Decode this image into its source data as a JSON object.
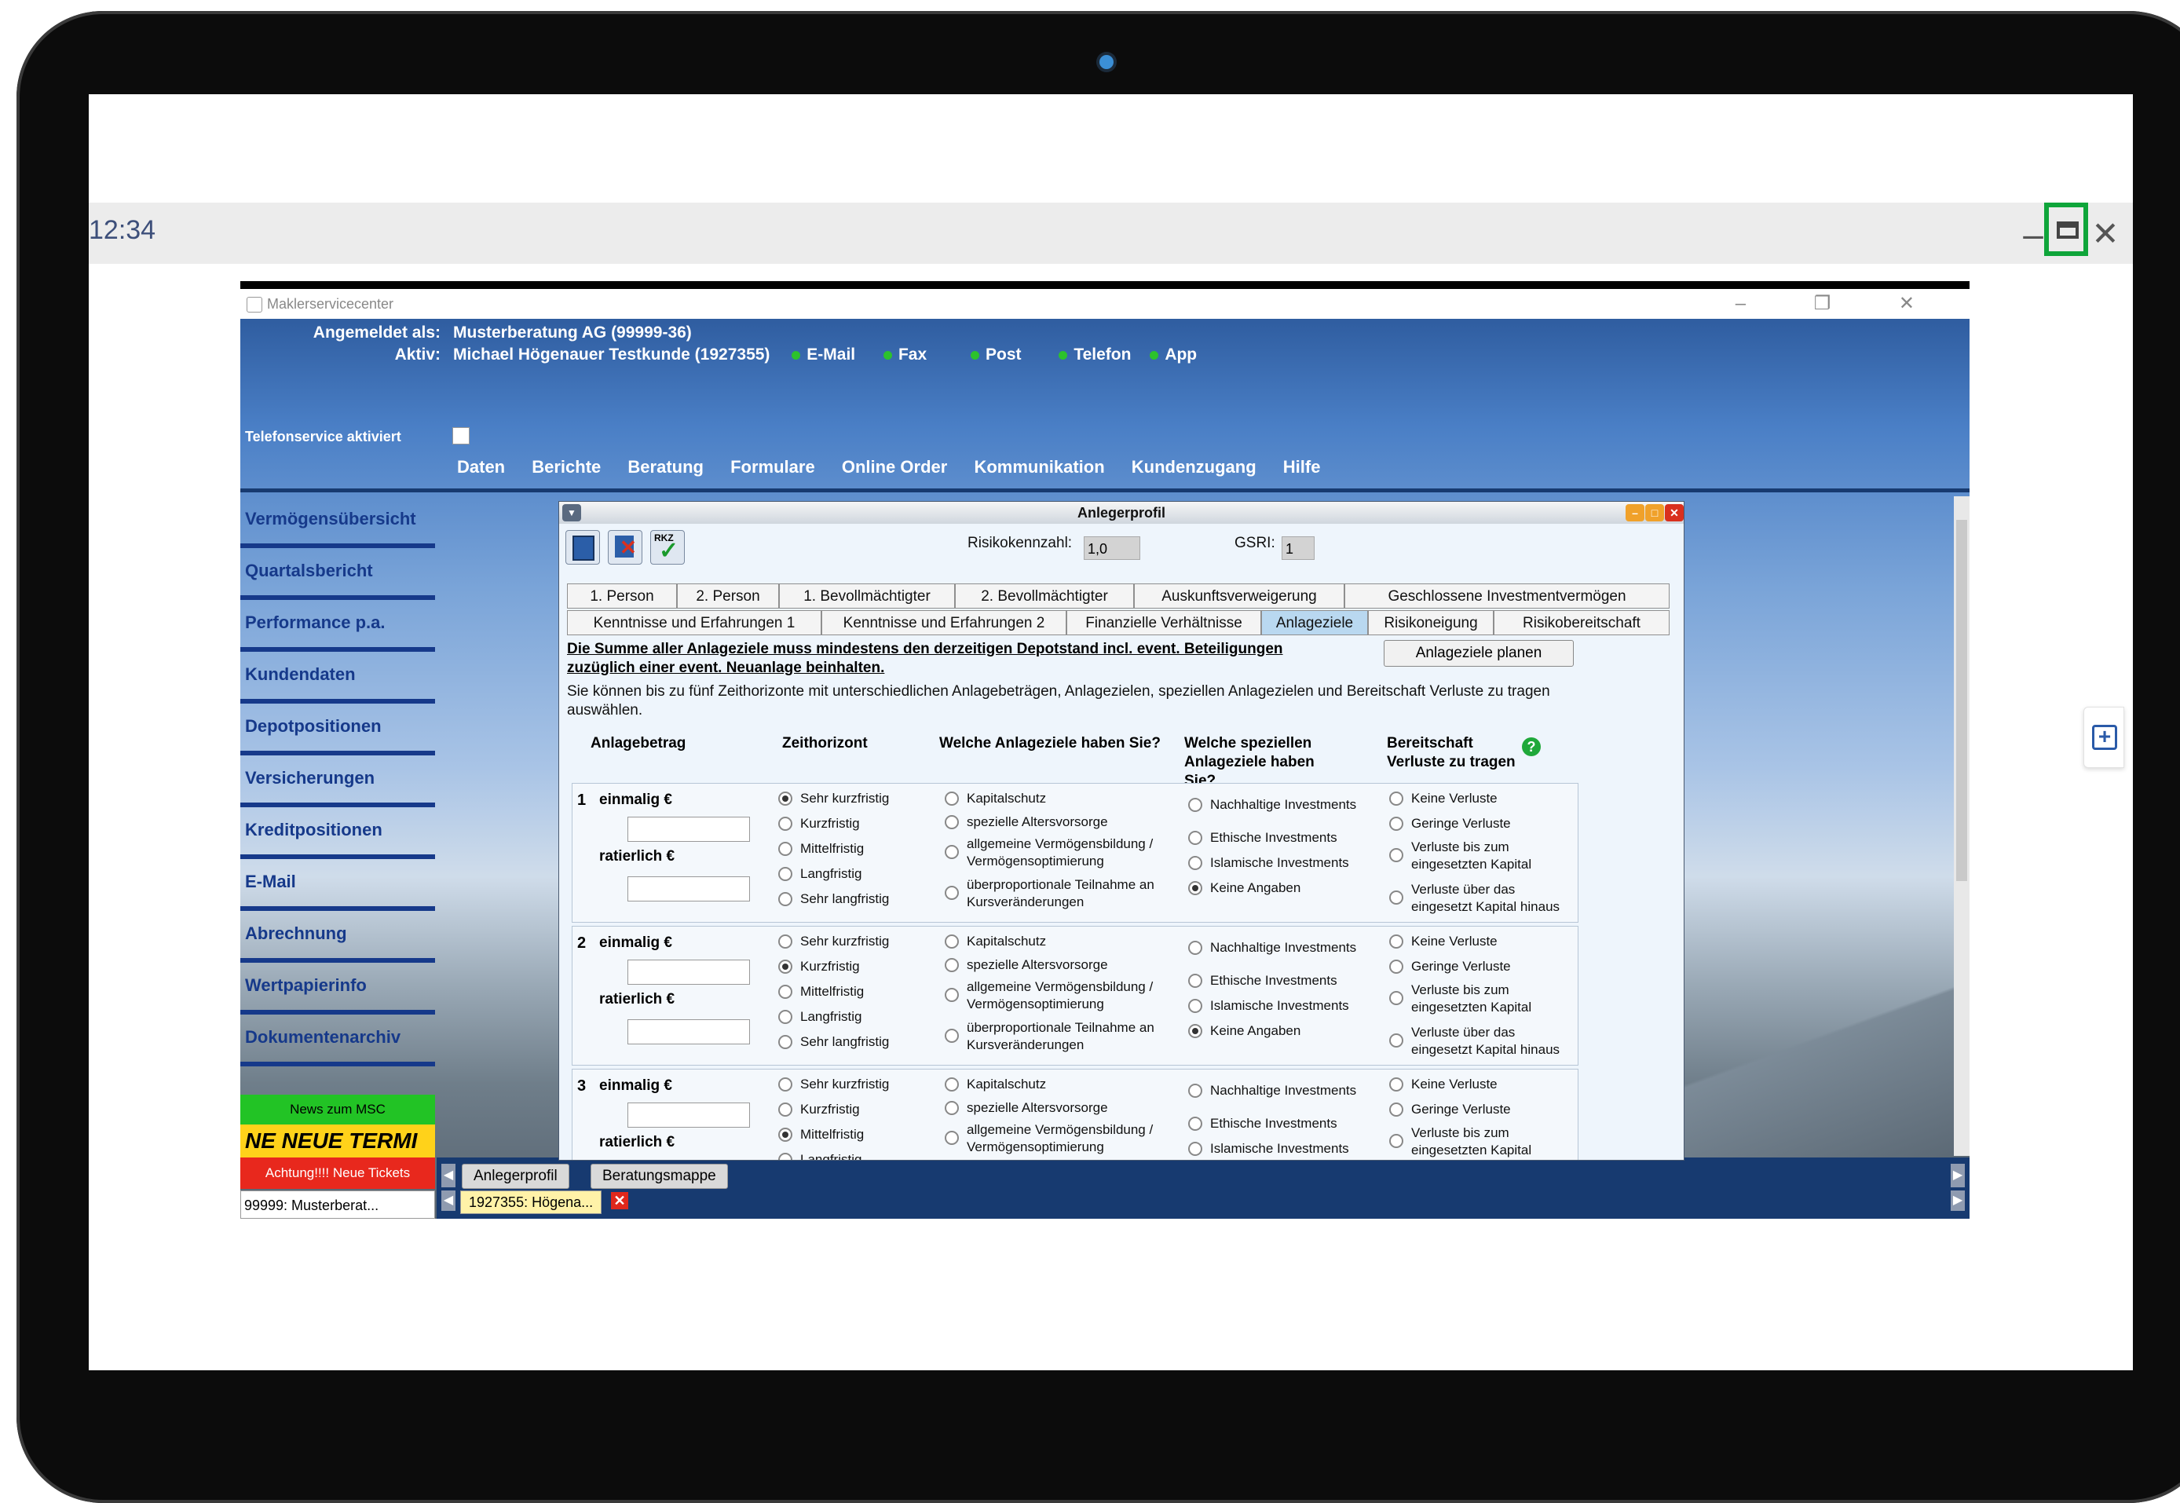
{
  "viewer": {
    "time": "12:34",
    "min_icon": "minimize-icon",
    "max_icon": "maximize-icon",
    "close_icon": "close-icon",
    "highlight_color": "#0fa53a"
  },
  "app": {
    "window_title": "Maklerservicecenter",
    "logged_in_label": "Angemeldet als:",
    "logged_in_value": "Musterberatung AG (99999-36)",
    "active_label": "Aktiv:",
    "active_value": "Michael Högenauer Testkunde (1927355)",
    "channels": [
      "E-Mail",
      "Fax",
      "Post",
      "Telefon",
      "App"
    ],
    "telefonservice": "Telefonservice aktiviert",
    "menu": [
      "Daten",
      "Berichte",
      "Beratung",
      "Formulare",
      "Online Order",
      "Kommunikation",
      "Kundenzugang",
      "Hilfe"
    ]
  },
  "nav": {
    "items": [
      "Vermögensübersicht",
      "Quartalsbericht",
      "Performance p.a.",
      "Kundendaten",
      "Depotpositionen",
      "Versicherungen",
      "Kreditpositionen",
      "E-Mail",
      "Abrechnung",
      "Wertpapierinfo",
      "Dokumentenarchiv"
    ],
    "news": "News zum MSC",
    "ticker": "NE  NEUE TERMI",
    "alert": "Achtung!!!! Neue Tickets",
    "client": "99999: Musterberat..."
  },
  "bottom": {
    "tabs": [
      "Anlegerprofil",
      "Beratungsmappe"
    ],
    "client_tab": "1927355: Högena...",
    "close_x": "✕"
  },
  "dialog": {
    "title": "Anlegerprofil",
    "risk_label": "Risikokennzahl:",
    "risk_value": "1,0",
    "gsri_label": "GSRI:",
    "gsri_value": "1",
    "rkz_text": "RKZ",
    "tabs_row1": [
      "1. Person",
      "2. Person",
      "1. Bevollmächtigter",
      "2. Bevollmächtigter",
      "Auskunftsverweigerung",
      "Geschlossene Investmentvermögen"
    ],
    "tabs_row2": [
      "Kenntnisse und Erfahrungen 1",
      "Kenntnisse und Erfahrungen 2",
      "Finanzielle Verhältnisse",
      "Anlageziele",
      "Risikoneigung",
      "Risikobereitschaft"
    ],
    "active_tab": "Anlageziele",
    "note_bold": "Die Summe aller Anlageziele muss mindestens den derzeitigen Depotstand incl. event. Beteiligungen zuzüglich einer event. Neuanlage beinhalten.",
    "note": "Sie können bis zu fünf Zeithorizonte mit unterschiedlichen Anlagebeträgen, Anlagezielen, speziellen Anlagezielen und Bereitschaft Verluste zu tragen auswählen.",
    "plan_button": "Anlageziele planen",
    "columns": [
      "Anlagebetrag",
      "Zeithorizont",
      "Welche Anlageziele haben Sie?",
      "Welche speziellen Anlageziele haben Sie?",
      "Bereitschaft Verluste zu tragen"
    ],
    "help": "?",
    "einmalig": "einmalig €",
    "ratierlich": "ratierlich €",
    "horizons": [
      "Sehr kurzfristig",
      "Kurzfristig",
      "Mittelfristig",
      "Langfristig",
      "Sehr langfristig"
    ],
    "goals": [
      "Kapitalschutz",
      "spezielle Altersvorsorge",
      "allgemeine Vermögensbildung / Vermögensoptimierung",
      "überproportionale Teilnahme an Kursveränderungen"
    ],
    "special": [
      "Nachhaltige Investments",
      "Ethische Investments",
      "Islamische Investments",
      "Keine Angaben"
    ],
    "losses": [
      "Keine Verluste",
      "Geringe Verluste",
      "Verluste bis zum eingesetzten Kapital",
      "Verluste über das eingesetzt Kapital hinaus"
    ],
    "groups": [
      {
        "num": "1",
        "horizon_selected": 0,
        "special_selected": 3
      },
      {
        "num": "2",
        "horizon_selected": 1,
        "special_selected": 3
      },
      {
        "num": "3",
        "horizon_selected": 2,
        "special_selected": -1
      }
    ]
  }
}
